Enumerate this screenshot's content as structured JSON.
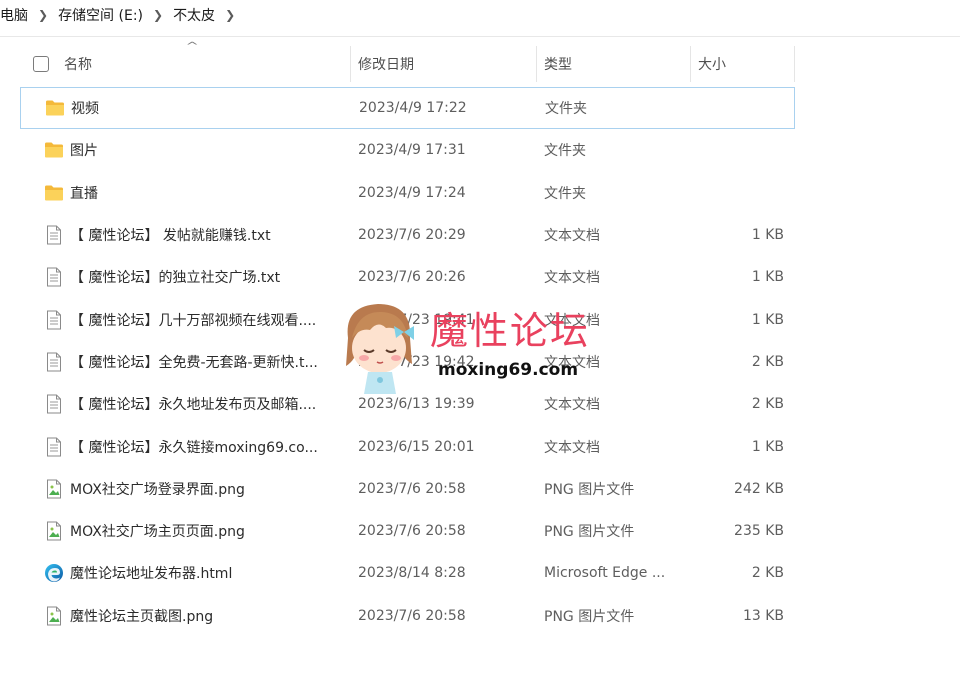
{
  "breadcrumb": {
    "items": [
      "电脑",
      "存储空间 (E:)",
      "不太皮"
    ]
  },
  "columns": {
    "name": "名称",
    "date": "修改日期",
    "type": "类型",
    "size": "大小"
  },
  "files": [
    {
      "icon": "folder-icon",
      "name": "视频",
      "date": "2023/4/9 17:22",
      "type": "文件夹",
      "size": "",
      "selected": true
    },
    {
      "icon": "folder-icon",
      "name": "图片",
      "date": "2023/4/9 17:31",
      "type": "文件夹",
      "size": ""
    },
    {
      "icon": "folder-icon",
      "name": "直播",
      "date": "2023/4/9 17:24",
      "type": "文件夹",
      "size": ""
    },
    {
      "icon": "text-file-icon",
      "name": "【 魔性论坛】 发帖就能赚钱.txt",
      "date": "2023/7/6 20:29",
      "type": "文本文档",
      "size": "1 KB"
    },
    {
      "icon": "text-file-icon",
      "name": "【 魔性论坛】的独立社交广场.txt",
      "date": "2023/7/6 20:26",
      "type": "文本文档",
      "size": "1 KB"
    },
    {
      "icon": "text-file-icon",
      "name": "【 魔性论坛】几十万部视频在线观看....",
      "date": "2023/7/23 19:41",
      "type": "文本文档",
      "size": "1 KB"
    },
    {
      "icon": "text-file-icon",
      "name": "【 魔性论坛】全免费-无套路-更新快.t...",
      "date": "2023/7/23 19:42",
      "type": "文本文档",
      "size": "2 KB"
    },
    {
      "icon": "text-file-icon",
      "name": "【 魔性论坛】永久地址发布页及邮箱....",
      "date": "2023/6/13 19:39",
      "type": "文本文档",
      "size": "2 KB"
    },
    {
      "icon": "text-file-icon",
      "name": "【 魔性论坛】永久链接moxing69.co...",
      "date": "2023/6/15 20:01",
      "type": "文本文档",
      "size": "1 KB"
    },
    {
      "icon": "image-file-icon",
      "name": "MOX社交广场登录界面.png",
      "date": "2023/7/6 20:58",
      "type": "PNG 图片文件",
      "size": "242 KB"
    },
    {
      "icon": "image-file-icon",
      "name": "MOX社交广场主页页面.png",
      "date": "2023/7/6 20:58",
      "type": "PNG 图片文件",
      "size": "235 KB"
    },
    {
      "icon": "edge-icon",
      "name": "魔性论坛地址发布器.html",
      "date": "2023/8/14 8:28",
      "type": "Microsoft Edge ...",
      "size": "2 KB"
    },
    {
      "icon": "image-file-icon",
      "name": "魔性论坛主页截图.png",
      "date": "2023/7/6 20:58",
      "type": "PNG 图片文件",
      "size": "13 KB"
    }
  ],
  "watermark": {
    "title": "魔性论坛",
    "url": "moxing69.com"
  },
  "colors": {
    "selection_border": "#a9d1ef",
    "folder": "#f8c948",
    "watermark": "#e9415e"
  }
}
